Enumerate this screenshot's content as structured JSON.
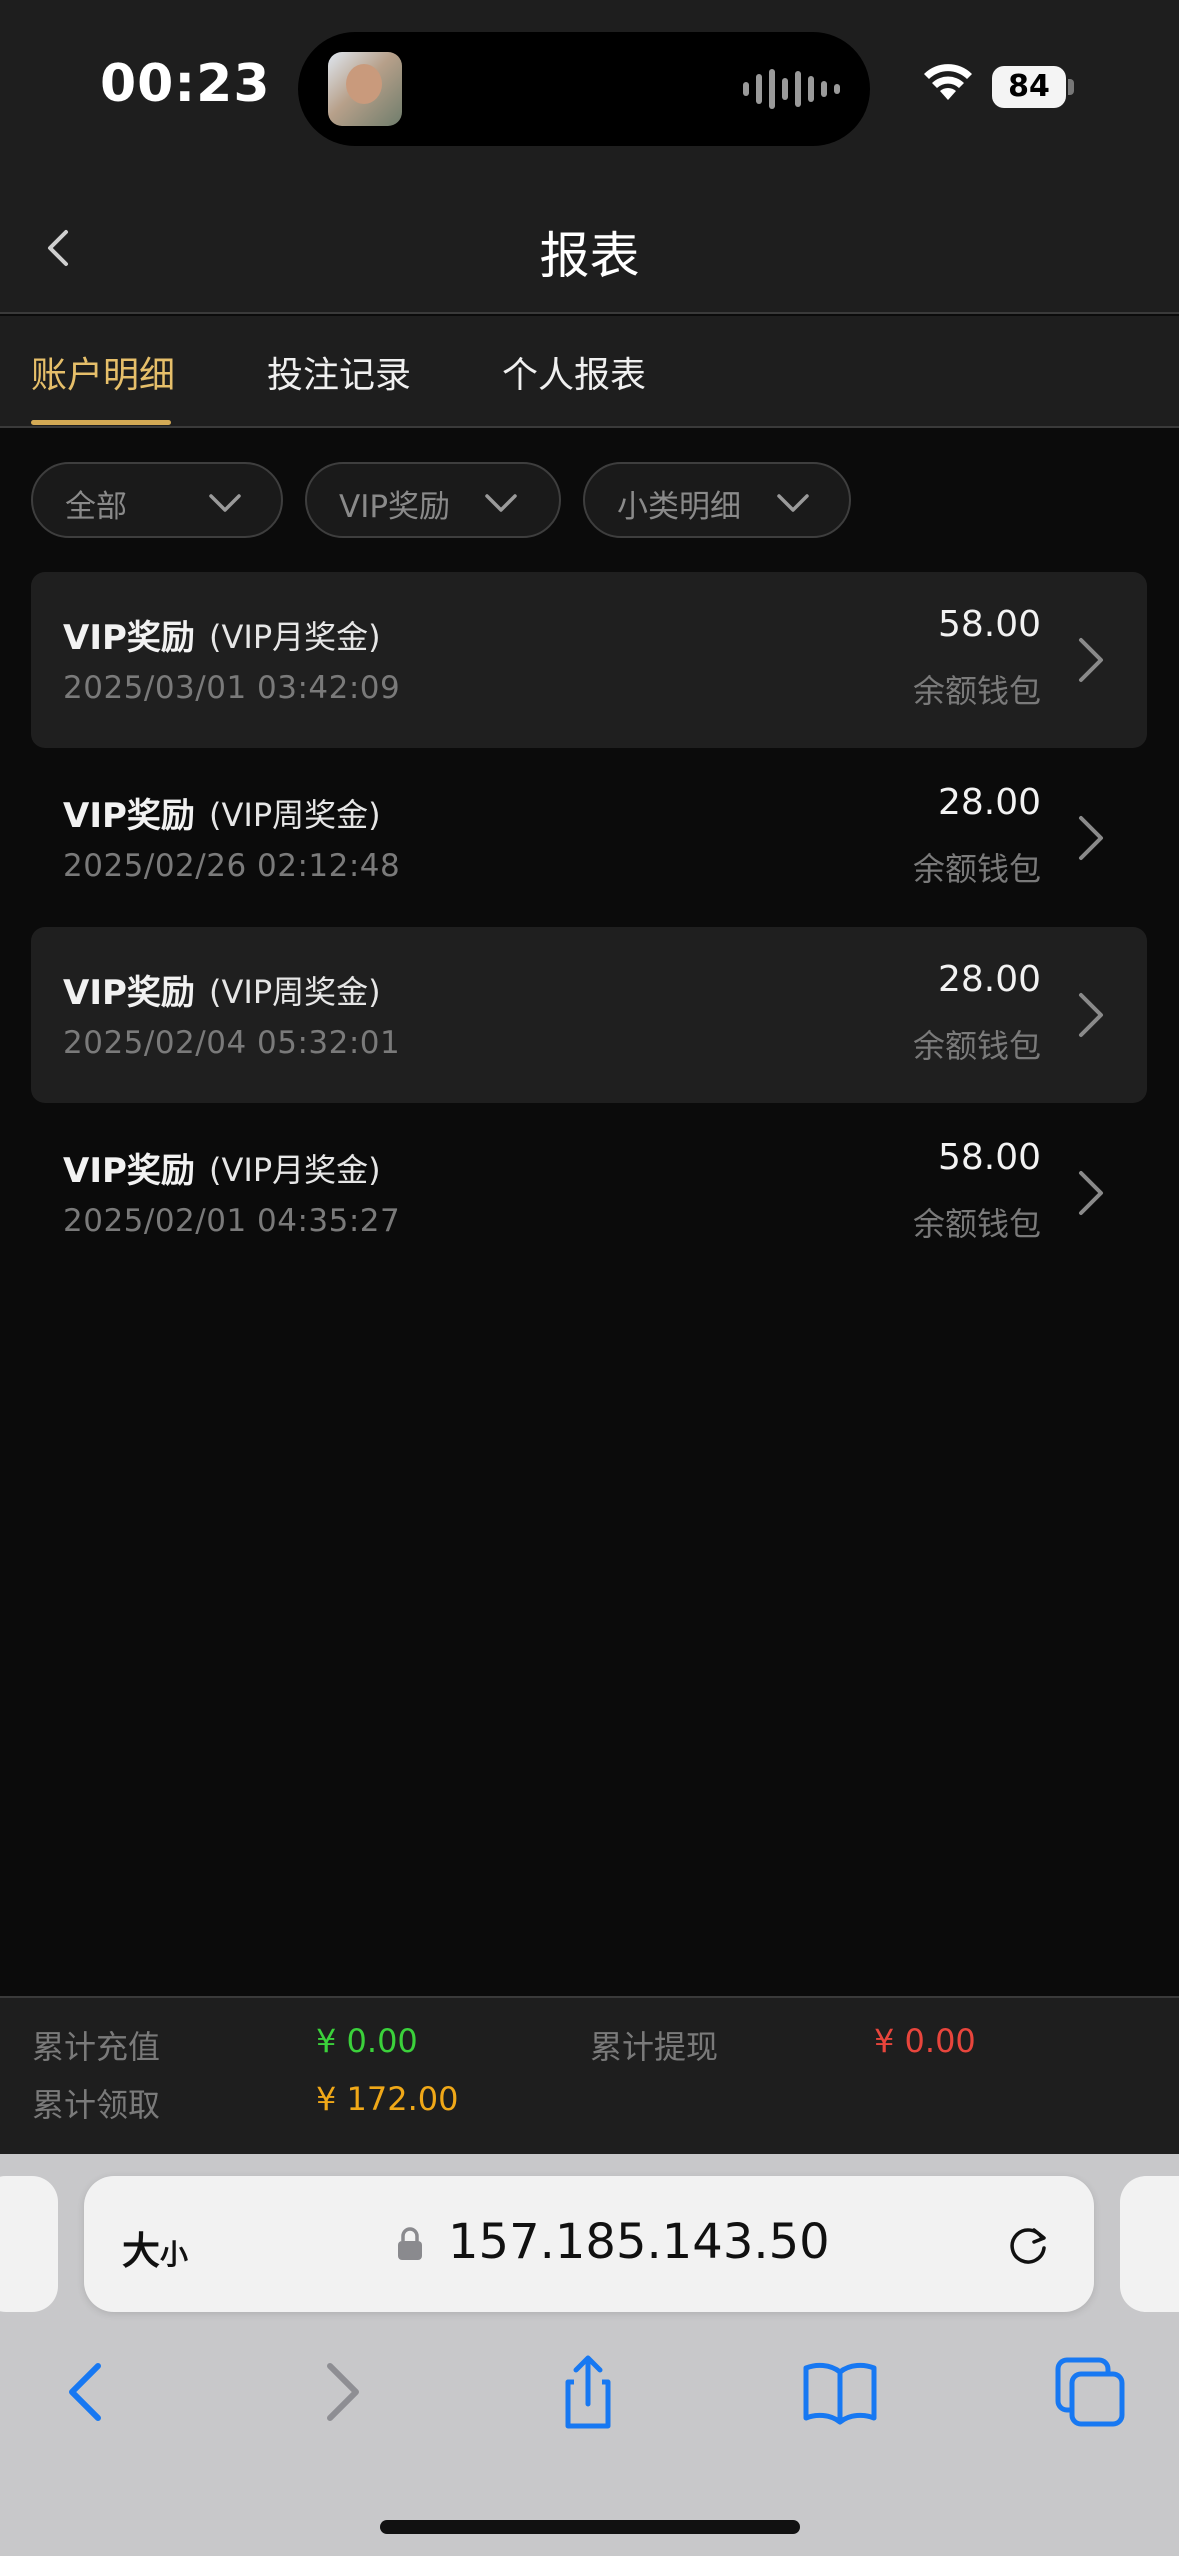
{
  "status_bar": {
    "time": "00:23",
    "battery": "84"
  },
  "nav": {
    "title": "报表"
  },
  "tabs": [
    {
      "label": "账户明细",
      "active": true
    },
    {
      "label": "投注记录",
      "active": false
    },
    {
      "label": "个人报表",
      "active": false
    }
  ],
  "filters": [
    {
      "label": "全部"
    },
    {
      "label": "VIP奖励"
    },
    {
      "label": "小类明细"
    }
  ],
  "records": [
    {
      "title": "VIP奖励",
      "subtitle": "(VIP月奖金)",
      "datetime": "2025/03/01 03:42:09",
      "amount": "58.00",
      "wallet": "余额钱包"
    },
    {
      "title": "VIP奖励",
      "subtitle": "(VIP周奖金)",
      "datetime": "2025/02/26 02:12:48",
      "amount": "28.00",
      "wallet": "余额钱包"
    },
    {
      "title": "VIP奖励",
      "subtitle": "(VIP周奖金)",
      "datetime": "2025/02/04 05:32:01",
      "amount": "28.00",
      "wallet": "余额钱包"
    },
    {
      "title": "VIP奖励",
      "subtitle": "(VIP月奖金)",
      "datetime": "2025/02/01 04:35:27",
      "amount": "58.00",
      "wallet": "余额钱包"
    }
  ],
  "summary": {
    "total_deposit_label": "累计充值",
    "total_deposit_value": "¥ 0.00",
    "total_withdraw_label": "累计提现",
    "total_withdraw_value": "¥ 0.00",
    "total_claimed_label": "累计领取",
    "total_claimed_value": "¥ 172.00"
  },
  "colors": {
    "accent": "#d4aa55",
    "deposit": "#3bd13b",
    "withdraw": "#e8453c",
    "claimed": "#f0a818"
  },
  "browser": {
    "text_size_big": "大",
    "text_size_small": "小",
    "url": "157.185.143.50"
  }
}
